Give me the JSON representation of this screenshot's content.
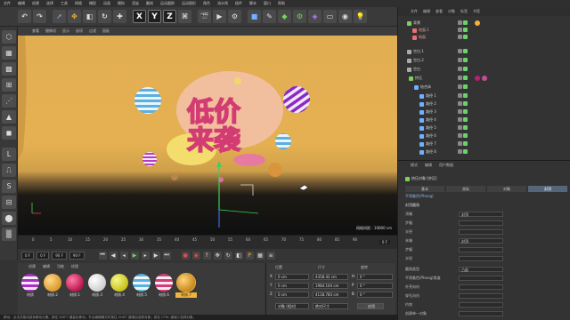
{
  "menu": {
    "items": [
      "文件",
      "编辑",
      "创建",
      "选择",
      "工具",
      "网格",
      "捕捉",
      "动画",
      "模拟",
      "渲染",
      "雕刻",
      "运动跟踪",
      "运动图形",
      "角色",
      "流水线",
      "插件",
      "脚本",
      "窗口",
      "帮助"
    ]
  },
  "toolbar": {
    "axis_x": "X",
    "axis_y": "Y",
    "axis_z": "Z"
  },
  "viewport": {
    "menu": [
      "查看",
      "摄像机",
      "显示",
      "选项",
      "过滤",
      "面板"
    ],
    "scale_label": "网格间距 : 10000 cm",
    "title_line1": "低价",
    "title_line2": "来袭"
  },
  "timeline": {
    "ticks": [
      "0",
      "5",
      "10",
      "15",
      "20",
      "25",
      "30",
      "35",
      "40",
      "45",
      "50",
      "55",
      "60",
      "65",
      "70",
      "75",
      "80",
      "85",
      "90"
    ],
    "frame_display": "0 F"
  },
  "transport": {
    "start_frame": "0 F",
    "current_frame": "0 F",
    "end_frame": "90 F",
    "end_frame2": "90 F"
  },
  "materials": {
    "menu": [
      "创建",
      "编辑",
      "功能",
      "纹理"
    ],
    "items": [
      "材质",
      "材质.2",
      "材质.1",
      "材质.3",
      "材质.4",
      "材质.5",
      "材质.6",
      "材质.7"
    ]
  },
  "coordinates": {
    "header_position": "位置",
    "header_size": "尺寸",
    "header_rotation": "旋转",
    "rows": [
      {
        "axis": "X",
        "pos": "0 cm",
        "size": "4358.42 cm",
        "rot_axis": "H",
        "rot": "0 °"
      },
      {
        "axis": "Y",
        "pos": "0 cm",
        "size": "1984.104 cm",
        "rot_axis": "P",
        "rot": "0 °"
      },
      {
        "axis": "Z",
        "pos": "0 cm",
        "size": "4118.783 cm",
        "rot_axis": "B",
        "rot": "0 °"
      }
    ],
    "mode_select": "对象 (相对)",
    "size_select": "绝对尺寸",
    "apply_button": "应用"
  },
  "object_manager": {
    "tabs": [
      "文件",
      "编辑",
      "查看",
      "对象",
      "标签",
      "书签"
    ],
    "rows": [
      "背景",
      "地面.1",
      "地面",
      "空白.1",
      "空白.2",
      "空白",
      "挤压",
      "结合体",
      "路径 1",
      "路径 2",
      "路径 3",
      "路径 4",
      "路径 5",
      "路径 6",
      "路径 7",
      "路径 8"
    ]
  },
  "attribute_manager": {
    "tabs": [
      "模式",
      "编辑",
      "用户数据"
    ],
    "object_title": "挤压对象 [挤压]",
    "subtabs": [
      "基本",
      "坐标",
      "对象",
      "封顶"
    ],
    "section_label": "平滑着色(Phong)",
    "group_title": "封顶圆角",
    "fields": [
      {
        "label": "顶端",
        "value": "封顶"
      },
      {
        "label": "步幅",
        "value": ""
      },
      {
        "label": "半径",
        "value": ""
      },
      {
        "label": "末端",
        "value": "封顶"
      },
      {
        "label": "步幅",
        "value": ""
      },
      {
        "label": "半径",
        "value": ""
      },
      {
        "label": "圆角类型",
        "value": "凸起"
      },
      {
        "label": "平滑着色(Phong)角度",
        "value": ""
      },
      {
        "label": "外壳向内",
        "value": ""
      },
      {
        "label": "穿孔向内",
        "value": ""
      },
      {
        "label": "约束",
        "value": ""
      },
      {
        "label": "创建单一对象",
        "value": ""
      }
    ]
  },
  "status": {
    "text": "移动：点击并拖动鼠标移动元素。按住 SHIFT 键量化移动；节点编辑模式时按住 SHIFT 键增加选择对象；按住 CTRL 键减少选择对象。"
  },
  "colors": {
    "accent": "#f0b43c",
    "bg_dark": "#333333",
    "viewport_yellow": "#e3af52"
  }
}
